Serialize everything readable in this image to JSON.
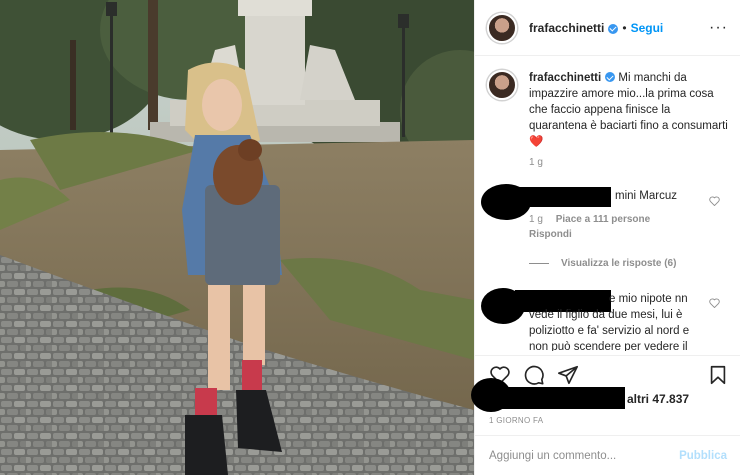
{
  "post": {
    "username": "frafacchinetti",
    "separator": "•",
    "follow_label": "Segui",
    "more_label": "···",
    "caption_user": "frafacchinetti",
    "caption_text": "Mi manchi da impazzire amore mio...la prima cosa che faccio appena finisce la quarantena è baciarti fino a consumarti❤️",
    "caption_time": "1 g",
    "likes_text": "altri 47.837",
    "date": "1 GIORNO FA",
    "comment_placeholder": "Aggiungi un commento...",
    "publish_label": "Pubblica"
  },
  "comments": [
    {
      "text": "mini Marcuz",
      "time": "1 g",
      "likes": "Piace a 111 persone",
      "reply": "Rispondi",
      "view_replies": "Visualizza le risposte (6)"
    },
    {
      "text": "e mio nipote nn vede il figlio da due mesi, lui è poliziotto e fa' servizio al nord e non può scendere per vedere il"
    }
  ],
  "icons": [
    "verified-icon",
    "more-icon",
    "heart-icon",
    "comment-icon",
    "share-icon",
    "bookmark-icon"
  ],
  "colors": {
    "accent": "#0095f6",
    "verified": "#3897f0",
    "muted": "#8e8e8e",
    "publish_disabled": "#b2dffc"
  }
}
